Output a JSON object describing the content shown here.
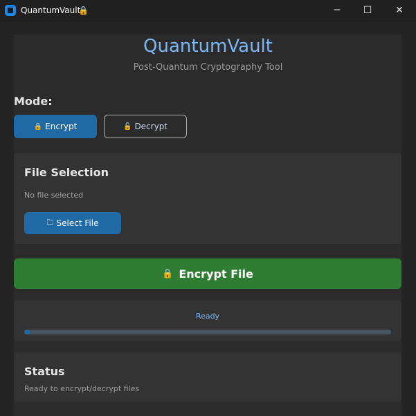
{
  "window": {
    "title": "QuantumVault",
    "title_icon": "lock-icon",
    "controls": {
      "minimize": "─",
      "maximize": "☐",
      "close": "✕"
    }
  },
  "header": {
    "title": "QuantumVault",
    "subtitle": "Post-Quantum Cryptography Tool"
  },
  "mode": {
    "label": "Mode:",
    "encrypt_label": "Encrypt",
    "decrypt_label": "Decrypt",
    "selected": "Encrypt"
  },
  "file_selection": {
    "heading": "File Selection",
    "status": "No file selected",
    "select_button": "Select File"
  },
  "action": {
    "button_label": "Encrypt File"
  },
  "progress": {
    "text": "Ready",
    "fraction": 0.015
  },
  "status_panel": {
    "heading": "Status",
    "text": "Ready to encrypt/decrypt files"
  },
  "icons": {
    "lock": "🔒",
    "unlock": "🔓",
    "folder": "🗀"
  },
  "colors": {
    "accent_blue": "#1f6aa5",
    "heading_blue": "#7ab8f5",
    "action_green": "#2e7d32",
    "background": "#242424",
    "panel": "#333333"
  }
}
